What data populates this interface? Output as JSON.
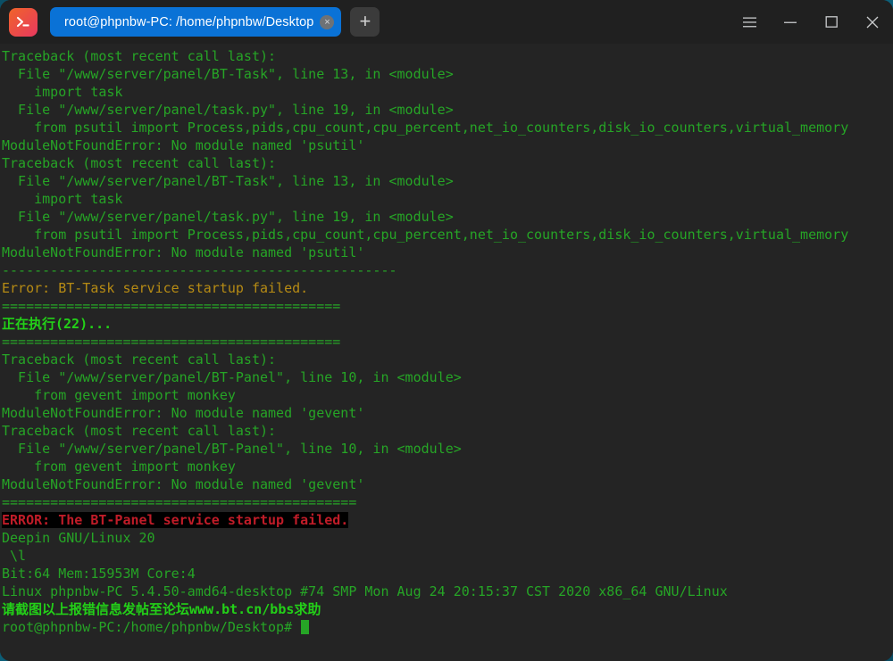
{
  "window": {
    "app_icon": "terminal-prompt-icon",
    "tab": {
      "title": "root@phpnbw-PC: /home/phpnbw/Desktop",
      "close_label": "×"
    },
    "new_tab_label": "+",
    "controls": {
      "menu": "hamburger-menu-icon",
      "minimize": "minimize-icon",
      "maximize": "maximize-icon",
      "close": "close-icon"
    }
  },
  "colors": {
    "titlebar_bg": "#202020",
    "terminal_bg": "#242424",
    "tab_active": "#0a72d6",
    "text_green": "#26a526",
    "text_bright_green": "#23d018",
    "text_yellow": "#b68b14",
    "text_error_red": "#c01c28",
    "error_highlight_bg": "#000000",
    "desktop": "#0d6a86"
  },
  "terminal": {
    "lines": [
      {
        "text": "Traceback (most recent call last):",
        "style": "green"
      },
      {
        "text": "  File \"/www/server/panel/BT-Task\", line 13, in <module>",
        "style": "green"
      },
      {
        "text": "    import task",
        "style": "green"
      },
      {
        "text": "  File \"/www/server/panel/task.py\", line 19, in <module>",
        "style": "green"
      },
      {
        "text": "    from psutil import Process,pids,cpu_count,cpu_percent,net_io_counters,disk_io_counters,virtual_memory",
        "style": "green"
      },
      {
        "text": "ModuleNotFoundError: No module named 'psutil'",
        "style": "green"
      },
      {
        "text": "Traceback (most recent call last):",
        "style": "green"
      },
      {
        "text": "  File \"/www/server/panel/BT-Task\", line 13, in <module>",
        "style": "green"
      },
      {
        "text": "    import task",
        "style": "green"
      },
      {
        "text": "  File \"/www/server/panel/task.py\", line 19, in <module>",
        "style": "green"
      },
      {
        "text": "    from psutil import Process,pids,cpu_count,cpu_percent,net_io_counters,disk_io_counters,virtual_memory",
        "style": "green"
      },
      {
        "text": "ModuleNotFoundError: No module named 'psutil'",
        "style": "green"
      },
      {
        "text": "-------------------------------------------------",
        "style": "green"
      },
      {
        "text": "Error: BT-Task service startup failed.",
        "style": "yellow"
      },
      {
        "text": "==========================================",
        "style": "green"
      },
      {
        "text": "正在执行(22)...",
        "style": "bright-green"
      },
      {
        "text": "==========================================",
        "style": "green"
      },
      {
        "text": "Traceback (most recent call last):",
        "style": "green"
      },
      {
        "text": "  File \"/www/server/panel/BT-Panel\", line 10, in <module>",
        "style": "green"
      },
      {
        "text": "    from gevent import monkey",
        "style": "green"
      },
      {
        "text": "ModuleNotFoundError: No module named 'gevent'",
        "style": "green"
      },
      {
        "text": "Traceback (most recent call last):",
        "style": "green"
      },
      {
        "text": "  File \"/www/server/panel/BT-Panel\", line 10, in <module>",
        "style": "green"
      },
      {
        "text": "    from gevent import monkey",
        "style": "green"
      },
      {
        "text": "ModuleNotFoundError: No module named 'gevent'",
        "style": "green"
      },
      {
        "text": "============================================",
        "style": "green"
      },
      {
        "text": "ERROR: The BT-Panel service startup failed.",
        "style": "error-highlight"
      },
      {
        "text": "Deepin GNU/Linux 20",
        "style": "green"
      },
      {
        "text": " \\l",
        "style": "green"
      },
      {
        "text": "Bit:64 Mem:15953M Core:4",
        "style": "green"
      },
      {
        "text": "Linux phpnbw-PC 5.4.50-amd64-desktop #74 SMP Mon Aug 24 20:15:37 CST 2020 x86_64 GNU/Linux",
        "style": "green"
      },
      {
        "text": "请截图以上报错信息发帖至论坛www.bt.cn/bbs求助",
        "style": "bright-green"
      },
      {
        "text": "root@phpnbw-PC:/home/phpnbw/Desktop# ",
        "style": "green",
        "cursor": true
      }
    ]
  }
}
